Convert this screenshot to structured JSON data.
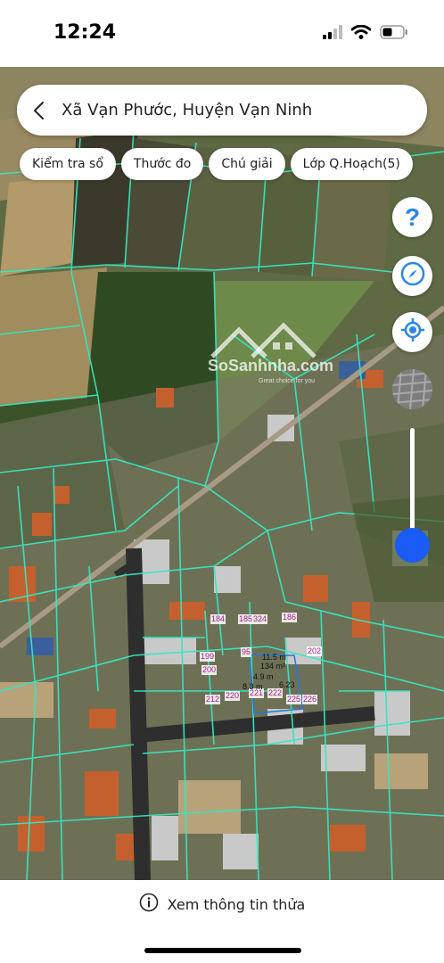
{
  "status": {
    "time": "12:24"
  },
  "search": {
    "title": "Xã Vạn Phước, Huyện Vạn Ninh"
  },
  "chips": [
    {
      "label": "Kiểm tra sổ"
    },
    {
      "label": "Thước đo"
    },
    {
      "label": "Chú giải"
    },
    {
      "label": "Lớp Q.Hoạch(5)"
    }
  ],
  "fab": {
    "help": "?"
  },
  "watermark": {
    "brand": "SoSanhnha.com",
    "tagline": "Great choice for you"
  },
  "parcels": [
    "184",
    "185",
    "324",
    "186",
    "199",
    "95",
    "202",
    "200",
    "212",
    "220",
    "221",
    "222",
    "225",
    "226"
  ],
  "measurements": [
    "11.5 m",
    "134 m²",
    "4.9 m",
    "8.3 m",
    "6.23"
  ],
  "bottom": {
    "info_label": "Xem thông tin thửa"
  },
  "colors": {
    "parcel_line": "#35e6c2",
    "accent": "#1a5cf6",
    "help": "#2a86e8"
  }
}
